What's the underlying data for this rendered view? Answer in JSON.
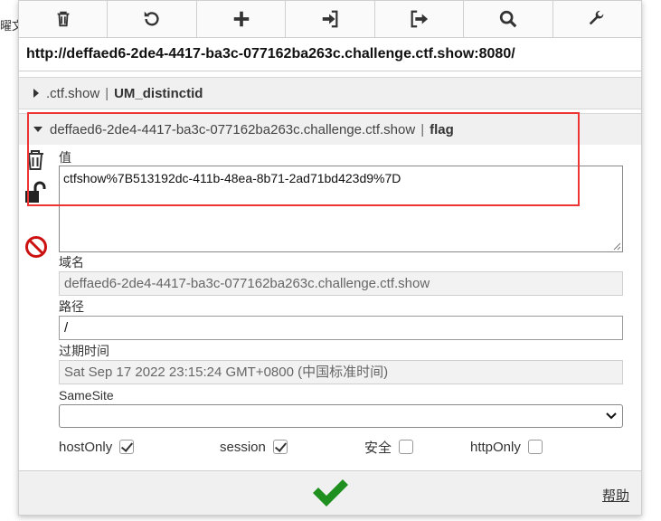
{
  "left_edge_text": "曜文",
  "toolbar": {
    "buttons": [
      {
        "name": "delete-all",
        "icon": "trash-icon"
      },
      {
        "name": "reset",
        "icon": "reload-icon"
      },
      {
        "name": "add",
        "icon": "plus-icon"
      },
      {
        "name": "import",
        "icon": "import-icon"
      },
      {
        "name": "export",
        "icon": "export-icon"
      },
      {
        "name": "search",
        "icon": "search-icon"
      },
      {
        "name": "options",
        "icon": "wrench-icon"
      }
    ]
  },
  "url": "http://deffaed6-2de4-4417-ba3c-077162ba263c.challenge.ctf.show:8080/",
  "cookies": [
    {
      "domain": ".ctf.show",
      "separator": "|",
      "name": "UM_distinctid",
      "expanded": false
    },
    {
      "domain": "deffaed6-2de4-4417-ba3c-077162ba263c.challenge.ctf.show",
      "separator": "|",
      "name": "flag",
      "expanded": true
    }
  ],
  "editor": {
    "value_label": "值",
    "value": "ctfshow%7B513192dc-411b-48ea-8b71-2ad71bd423d9%7D",
    "domain_label": "域名",
    "domain_value": "deffaed6-2de4-4417-ba3c-077162ba263c.challenge.ctf.show",
    "path_label": "路径",
    "path_value": "/",
    "expires_label": "过期时间",
    "expires_value": "Sat Sep 17 2022 23:15:24 GMT+0800 (中国标准时间)",
    "samesite_label": "SameSite",
    "samesite_value": "",
    "flags": {
      "hostonly_label": "hostOnly",
      "hostonly_checked": true,
      "session_label": "session",
      "session_checked": true,
      "secure_label": "安全",
      "secure_checked": false,
      "httponly_label": "httpOnly",
      "httponly_checked": false
    }
  },
  "footer": {
    "help_label": "帮助"
  },
  "colors": {
    "save_green": "#1f8f1f",
    "block_red": "#cc1111",
    "highlight_red": "#ee3333"
  }
}
